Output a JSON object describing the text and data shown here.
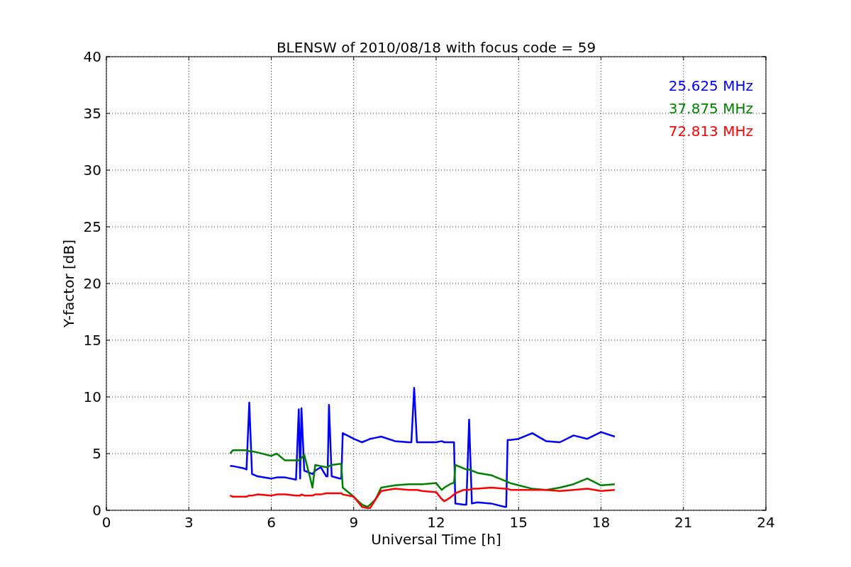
{
  "chart_data": {
    "type": "line",
    "title": "BLENSW of 2010/08/18 with focus code = 59",
    "xlabel": "Universal Time [h]",
    "ylabel": "Y-factor [dB]",
    "x": [
      4.5,
      4.6,
      5.0,
      5.1,
      5.2,
      5.3,
      5.5,
      6.0,
      6.2,
      6.5,
      6.9,
      7.0,
      7.05,
      7.1,
      7.2,
      7.4,
      7.5,
      7.6,
      7.8,
      8.0,
      8.05,
      8.1,
      8.2,
      8.5,
      8.55,
      8.6,
      9.0,
      9.3,
      9.5,
      9.6,
      9.8,
      10.0,
      10.5,
      11.0,
      11.1,
      11.2,
      11.3,
      11.5,
      12.0,
      12.2,
      12.3,
      12.5,
      12.6,
      12.65,
      12.7,
      13.0,
      13.1,
      13.2,
      13.3,
      13.5,
      14.0,
      14.5,
      14.55,
      14.6,
      14.7,
      15.0,
      15.5,
      16.0,
      16.5,
      17.0,
      17.5,
      18.0,
      18.5
    ],
    "series": [
      {
        "name": "25.625 MHz",
        "color": "#0000ff",
        "values": [
          3.9,
          3.9,
          3.7,
          3.6,
          9.5,
          3.2,
          3.0,
          2.8,
          2.9,
          2.9,
          2.7,
          8.9,
          2.8,
          9.0,
          3.5,
          3.3,
          3.2,
          3.5,
          3.8,
          3.0,
          3.0,
          9.3,
          3.0,
          2.8,
          2.8,
          6.8,
          6.3,
          6.0,
          6.2,
          6.3,
          6.4,
          6.5,
          6.1,
          6.0,
          6.0,
          10.8,
          6.0,
          6.0,
          6.0,
          6.1,
          6.0,
          6.0,
          6.0,
          6.0,
          0.6,
          0.5,
          0.5,
          8.0,
          0.6,
          0.7,
          0.6,
          0.3,
          0.3,
          6.2,
          6.2,
          6.3,
          6.8,
          6.1,
          6.0,
          6.6,
          6.3,
          6.9,
          6.5
        ]
      },
      {
        "name": "37.875 MHz",
        "color": "#008000",
        "values": [
          5.0,
          5.3,
          5.3,
          5.3,
          5.2,
          5.2,
          5.1,
          4.8,
          5.0,
          4.4,
          4.4,
          4.4,
          4.5,
          4.6,
          4.9,
          3.0,
          2.0,
          4.0,
          3.9,
          3.8,
          3.8,
          3.9,
          4.0,
          4.1,
          4.1,
          2.0,
          1.2,
          0.5,
          0.3,
          0.5,
          1.0,
          2.0,
          2.2,
          2.3,
          2.3,
          2.3,
          2.3,
          2.3,
          2.4,
          1.8,
          2.0,
          2.3,
          2.4,
          2.4,
          4.0,
          3.7,
          3.6,
          3.6,
          3.5,
          3.3,
          3.1,
          2.6,
          2.6,
          2.5,
          2.4,
          2.2,
          1.9,
          1.8,
          2.0,
          2.3,
          2.8,
          2.2,
          2.3
        ]
      },
      {
        "name": "72.813 MHz",
        "color": "#ff0000",
        "values": [
          1.3,
          1.2,
          1.2,
          1.2,
          1.3,
          1.3,
          1.4,
          1.3,
          1.4,
          1.4,
          1.3,
          1.3,
          1.3,
          1.4,
          1.3,
          1.3,
          1.3,
          1.4,
          1.4,
          1.5,
          1.5,
          1.5,
          1.5,
          1.5,
          1.5,
          1.4,
          1.2,
          0.3,
          0.2,
          0.2,
          1.0,
          1.7,
          1.9,
          1.8,
          1.8,
          1.8,
          1.8,
          1.7,
          1.6,
          1.0,
          0.8,
          1.1,
          1.3,
          1.4,
          1.5,
          1.8,
          1.8,
          1.8,
          1.9,
          1.9,
          2.0,
          1.9,
          1.9,
          1.9,
          1.8,
          1.8,
          1.8,
          1.8,
          1.7,
          1.8,
          1.9,
          1.7,
          1.8
        ]
      }
    ],
    "xlim": [
      0,
      24
    ],
    "ylim": [
      0,
      40
    ],
    "xticks": [
      0,
      3,
      6,
      9,
      12,
      15,
      18,
      21,
      24
    ],
    "yticks": [
      0,
      5,
      10,
      15,
      20,
      25,
      30,
      35,
      40
    ],
    "grid": true
  }
}
